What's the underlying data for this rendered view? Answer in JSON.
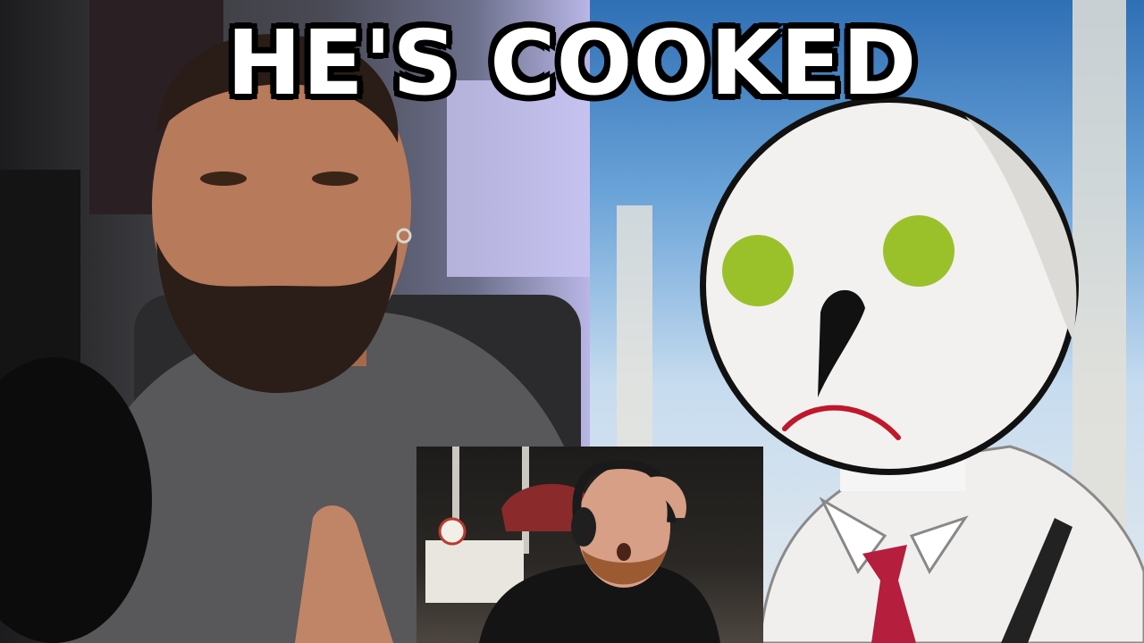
{
  "thumbnail": {
    "title": "HE'S COOKED"
  },
  "colors": {
    "title_text": "#ffffff",
    "title_outline": "#000000",
    "character_eyes": "#9bc12a",
    "character_mouth": "#c0172b",
    "character_tie": "#b51e3d"
  }
}
